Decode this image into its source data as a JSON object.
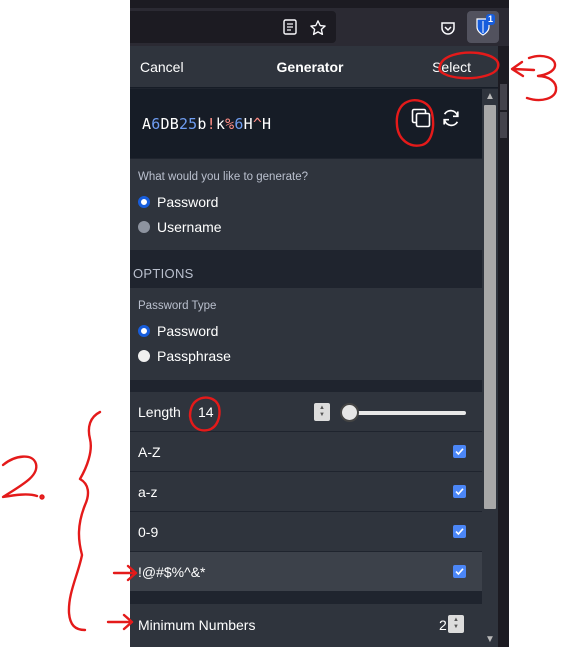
{
  "browser": {
    "icons": [
      "reader-view-icon",
      "bookmark-star-icon",
      "pocket-icon",
      "bitwarden-shield-icon"
    ],
    "extension_badge": "1"
  },
  "header": {
    "cancel_label": "Cancel",
    "title": "Generator",
    "select_label": "Select"
  },
  "generated": {
    "password": "A6DB25b!k%6H^H",
    "segments": [
      {
        "t": "A",
        "k": "l"
      },
      {
        "t": "6",
        "k": "n"
      },
      {
        "t": "DB",
        "k": "l"
      },
      {
        "t": "25",
        "k": "n"
      },
      {
        "t": "b",
        "k": "l"
      },
      {
        "t": "!",
        "k": "s"
      },
      {
        "t": "k",
        "k": "l"
      },
      {
        "t": "%",
        "k": "s"
      },
      {
        "t": "6",
        "k": "n"
      },
      {
        "t": "H",
        "k": "l"
      },
      {
        "t": "^",
        "k": "s"
      },
      {
        "t": "H",
        "k": "l"
      }
    ],
    "copy_icon": "copy-icon",
    "regenerate_icon": "regenerate-icon"
  },
  "generate_type": {
    "question": "What would you like to generate?",
    "options": [
      {
        "label": "Password",
        "selected": true
      },
      {
        "label": "Username",
        "selected": false
      }
    ]
  },
  "options": {
    "heading": "OPTIONS",
    "password_type": {
      "label": "Password Type",
      "options": [
        {
          "label": "Password",
          "selected": true
        },
        {
          "label": "Passphrase",
          "selected": false
        }
      ]
    },
    "length": {
      "label": "Length",
      "value": "14"
    },
    "checks": [
      {
        "label": "A-Z",
        "checked": true
      },
      {
        "label": "a-z",
        "checked": true
      },
      {
        "label": "0-9",
        "checked": true
      },
      {
        "label": "!@#$%^&*",
        "checked": true
      }
    ],
    "minimum_numbers": {
      "label": "Minimum Numbers",
      "value": "2"
    }
  },
  "colors": {
    "accent": "#175ddc",
    "checkbox": "#4b86f7",
    "number_char": "#6f9df1",
    "special_char": "#ff8d85",
    "annotation_red": "#e41a1a"
  },
  "annotations": {
    "label_2": "2.",
    "label_3": "3"
  }
}
